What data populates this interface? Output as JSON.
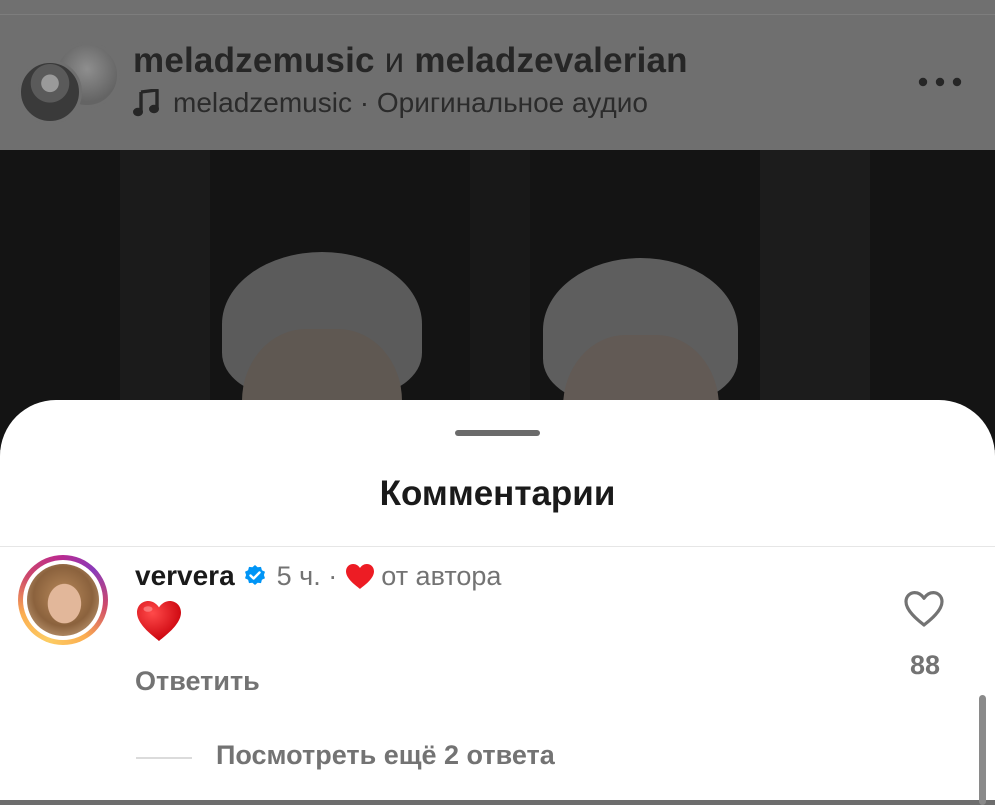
{
  "post": {
    "author_1": "meladzemusic",
    "author_separator": "и",
    "author_2": "meladzevalerian",
    "audio_owner": "meladzemusic",
    "audio_separator": "·",
    "audio_label": "Оригинальное аудио",
    "more_icon": "more-horizontal-icon",
    "music_icon": "music-note-icon"
  },
  "comments_sheet": {
    "title": "Комментарии"
  },
  "comment": {
    "username": "ververa",
    "verified_icon": "verified-badge-icon",
    "time": "5 ч.",
    "separator": "·",
    "author_like_label": "от автора",
    "text_emoji_icon": "red-heart-emoji-icon",
    "reply_label": "Ответить",
    "like_count": "88",
    "view_more_replies": "Посмотреть ещё 2 ответа"
  },
  "colors": {
    "dim_overlay": "#6f6f6f",
    "secondary_text": "#737373",
    "verified_blue": "#0095f6",
    "heart_red": "#ed1c24",
    "story_ring": "#cd486b"
  }
}
